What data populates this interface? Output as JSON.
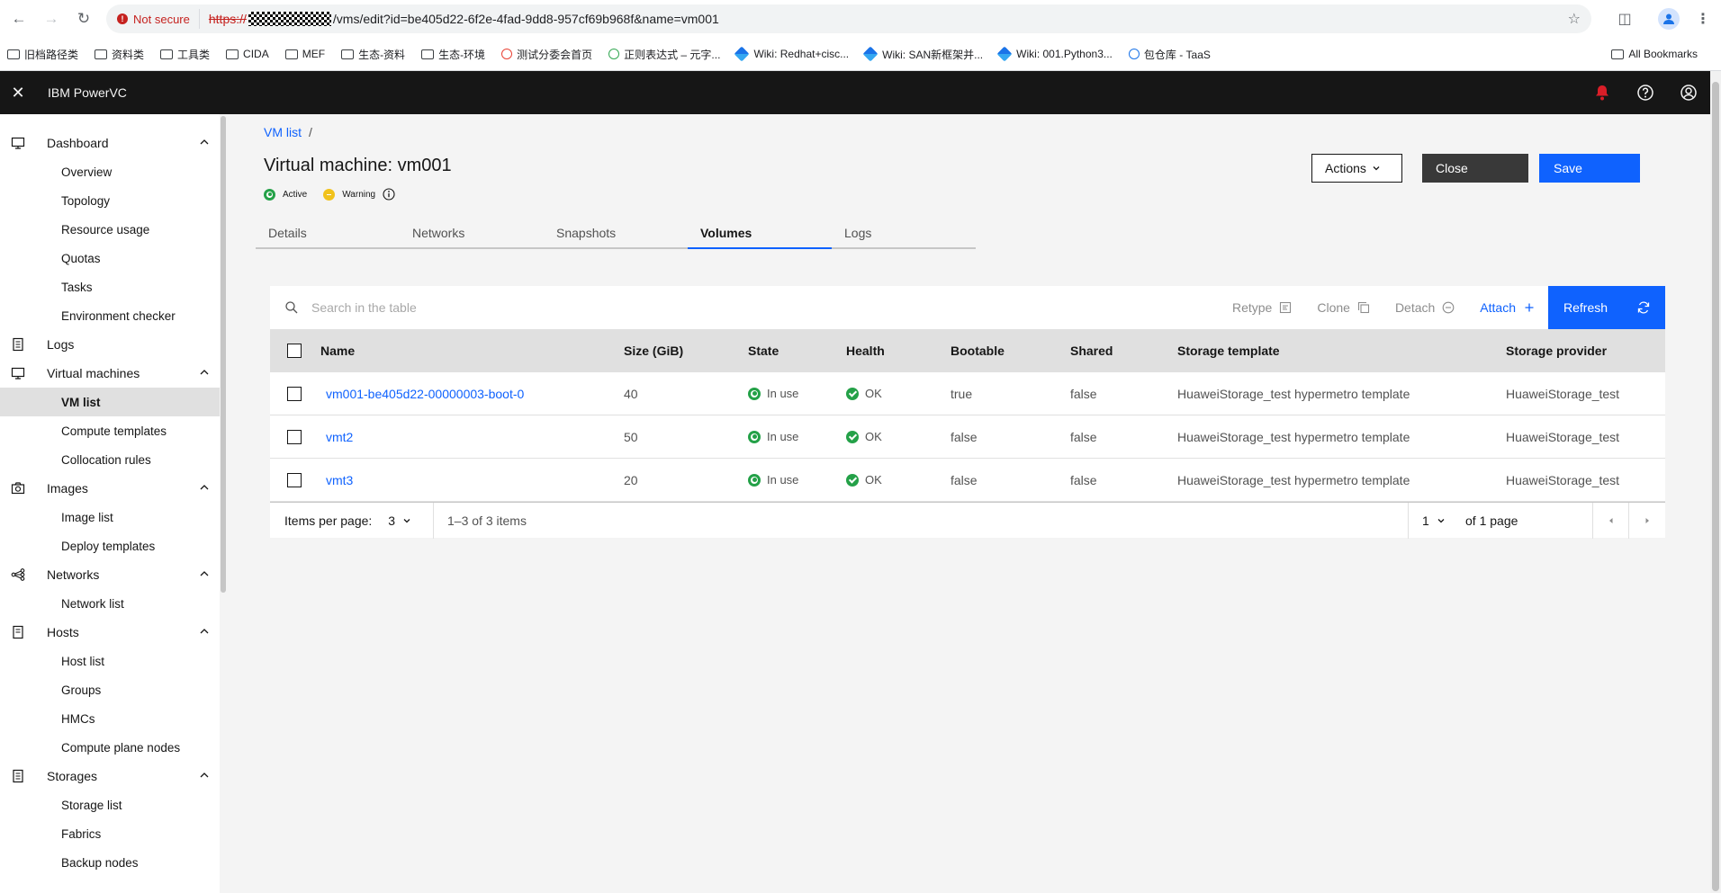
{
  "browser": {
    "not_secure": "Not secure",
    "url_scheme": "https://",
    "url_rest": "/vms/edit?id=be405d22-6f2e-4fad-9dd8-957cf69b968f&name=vm001",
    "bookmarks": [
      "旧档路径类",
      "资料类",
      "工具类",
      "CIDA",
      "MEF",
      "生态-资料",
      "生态-环境",
      "测试分委会首页",
      "正则表达式 – 元字...",
      "Wiki: Redhat+cisc...",
      "Wiki: SAN新框架并...",
      "Wiki: 001.Python3...",
      "包仓库 - TaaS"
    ],
    "all_bookmarks": "All Bookmarks"
  },
  "app": {
    "title": "IBM PowerVC"
  },
  "sidebar": {
    "groups": [
      {
        "label": "Dashboard",
        "items": [
          "Overview",
          "Topology",
          "Resource usage",
          "Quotas",
          "Tasks",
          "Environment checker"
        ]
      },
      {
        "label": "Logs",
        "items": []
      },
      {
        "label": "Virtual machines",
        "items": [
          "VM list",
          "Compute templates",
          "Collocation rules"
        ]
      },
      {
        "label": "Images",
        "items": [
          "Image list",
          "Deploy templates"
        ]
      },
      {
        "label": "Networks",
        "items": [
          "Network list"
        ]
      },
      {
        "label": "Hosts",
        "items": [
          "Host list",
          "Groups",
          "HMCs",
          "Compute plane nodes"
        ]
      },
      {
        "label": "Storages",
        "items": [
          "Storage list",
          "Fabrics",
          "Backup nodes"
        ]
      }
    ]
  },
  "main": {
    "breadcrumb": "VM list",
    "breadcrumb_sep": "/",
    "title": "Virtual machine: vm001",
    "status_active": "Active",
    "status_warning": "Warning",
    "actions_label": "Actions",
    "close_label": "Close",
    "save_label": "Save",
    "tabs": [
      "Details",
      "Networks",
      "Snapshots",
      "Volumes",
      "Logs"
    ],
    "active_tab": "Volumes"
  },
  "table": {
    "search_placeholder": "Search in the table",
    "toolbar": {
      "retype": "Retype",
      "clone": "Clone",
      "detach": "Detach",
      "attach": "Attach",
      "refresh": "Refresh"
    },
    "columns": [
      "Name",
      "Size (GiB)",
      "State",
      "Health",
      "Bootable",
      "Shared",
      "Storage template",
      "Storage provider"
    ],
    "rows": [
      {
        "name": "vm001-be405d22-00000003-boot-0",
        "size": "40",
        "state": "In use",
        "health": "OK",
        "bootable": "true",
        "shared": "false",
        "template": "HuaweiStorage_test hypermetro template",
        "provider": "HuaweiStorage_test"
      },
      {
        "name": "vmt2",
        "size": "50",
        "state": "In use",
        "health": "OK",
        "bootable": "false",
        "shared": "false",
        "template": "HuaweiStorage_test hypermetro template",
        "provider": "HuaweiStorage_test"
      },
      {
        "name": "vmt3",
        "size": "20",
        "state": "In use",
        "health": "OK",
        "bootable": "false",
        "shared": "false",
        "template": "HuaweiStorage_test hypermetro template",
        "provider": "HuaweiStorage_test"
      }
    ],
    "pager": {
      "items_per_page_label": "Items per page:",
      "items_per_page": "3",
      "range": "1–3 of 3 items",
      "page": "1",
      "of_pages": "of 1 page"
    }
  },
  "colors": {
    "primary": "#0f62fe",
    "header_bg": "#161616",
    "success": "#24a148",
    "warning": "#f1c21b",
    "notify": "#da1e28"
  }
}
